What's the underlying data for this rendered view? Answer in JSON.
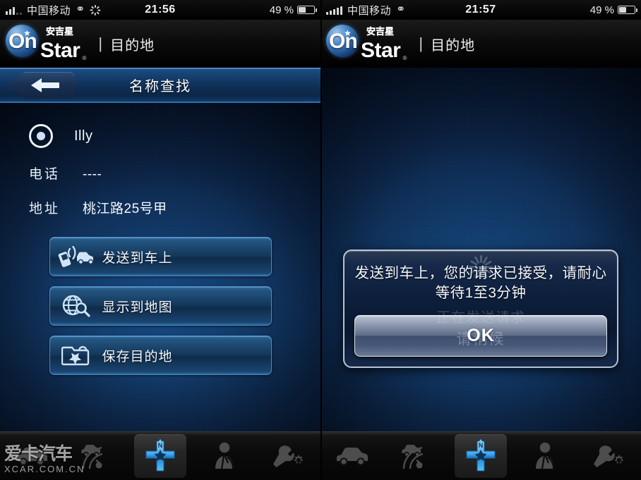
{
  "left": {
    "status": {
      "carrier": "中国移动",
      "time": "21:56",
      "battery_pct": "49 %",
      "signal_filled": 3,
      "signal_empty": 2,
      "edge_icon": "edge-network-icon",
      "activity_icon": "activity-spinner-icon"
    },
    "appbar": {
      "brand_on": "On",
      "brand_star": "Star",
      "brand_cn": "安吉星",
      "separator": "|",
      "title": "目的地"
    },
    "navbar": {
      "back_icon": "back-arrow-icon",
      "title": "名称查找"
    },
    "poi": {
      "name": "Illy",
      "phone_label": "电话",
      "phone_value": "----",
      "address_label": "地址",
      "address_value": "桃江路25号甲"
    },
    "actions": [
      {
        "label": "发送到车上",
        "icon": "phone-to-car-icon"
      },
      {
        "label": "显示到地图",
        "icon": "globe-search-icon"
      },
      {
        "label": "保存目的地",
        "icon": "folder-star-icon"
      }
    ]
  },
  "right": {
    "status": {
      "carrier": "中国移动",
      "time": "21:57",
      "battery_pct": "49 %",
      "signal_filled": 5,
      "signal_empty": 0,
      "edge_icon": "edge-network-icon"
    },
    "appbar": {
      "brand_on": "On",
      "brand_star": "Star",
      "brand_cn": "安吉星",
      "separator": "|",
      "title": "目的地"
    },
    "dialog": {
      "message": "发送到车上，您的请求已接受，请耐心等待1至3分钟",
      "ghost_message": "正在发送请求",
      "ok_label": "OK",
      "ok_ghost_label": "请稍候",
      "spinner_icon": "loading-spinner-icon"
    }
  },
  "tabbar": {
    "items": [
      {
        "name": "vehicle",
        "icon": "car-icon",
        "active": false
      },
      {
        "name": "diagnostics",
        "icon": "car-road-icon",
        "active": false
      },
      {
        "name": "destination",
        "icon": "compass-navigation-icon",
        "active": true
      },
      {
        "name": "advisor",
        "icon": "advisor-person-icon",
        "active": false
      },
      {
        "name": "settings",
        "icon": "wrench-gear-icon",
        "active": false
      }
    ]
  },
  "watermark": {
    "cn": "爱卡汽车",
    "en": "XCAR.COM.CN"
  },
  "colors": {
    "accent": "#2f6b9e",
    "navbar": "#174273",
    "logo_blue": "#3f7fc0",
    "active_tab": "#4fb4f0"
  }
}
